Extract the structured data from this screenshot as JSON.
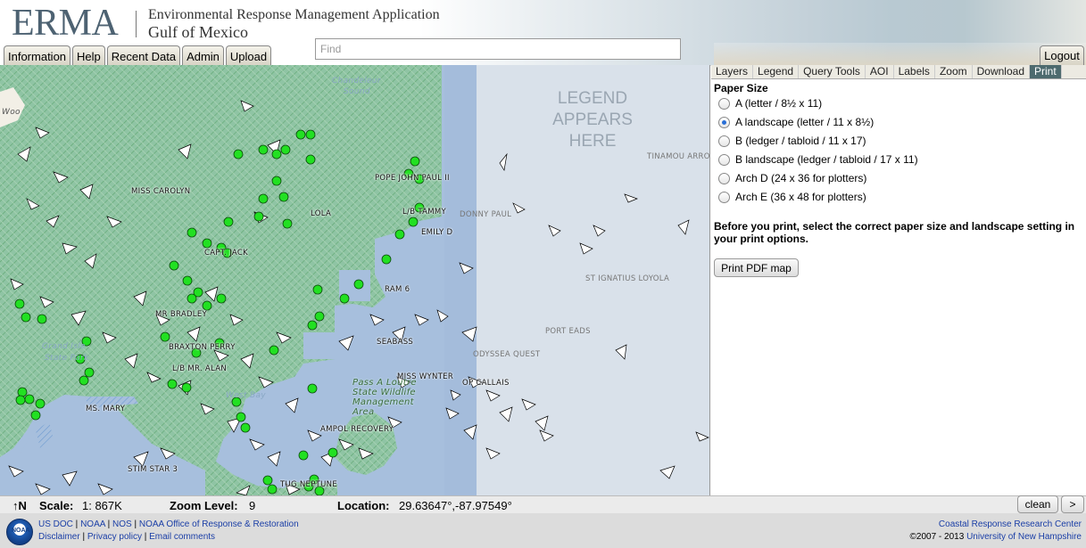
{
  "header": {
    "logo": "ERMA",
    "title": "Environmental Response Management Application",
    "subtitle": "Gulf of Mexico",
    "search_placeholder": "Find",
    "logout": "Logout"
  },
  "nav_tabs": [
    "Information",
    "Help",
    "Recent Data",
    "Admin",
    "Upload"
  ],
  "map": {
    "legend_placeholder": "LEGEND APPEARS HERE",
    "vessel_labels": [
      "MISS CAROLYN",
      "LOLA",
      "POPE JOHN PAUL II",
      "L/B TAMMY",
      "DONNY PAUL",
      "EMILY D",
      "CAPT. JACK",
      "RAM 6",
      "MR BRADLEY",
      "BRAXTON PERRY",
      "SEABASS",
      "L/B MR. ALAN",
      "MISS WYNTER",
      "OP CALLAIS",
      "MS. MARY",
      "AMPOL RECOVERY",
      "STIM STAR 3",
      "TUG NEPTUNE"
    ],
    "offshore_labels": [
      "TINAMOU ARRO",
      "ST IGNATIUS LOYOLA",
      "PORT EADS",
      "ODYSSEA QUEST"
    ],
    "place_labels": [
      "Chandeleur",
      "Sound",
      "Grand Isle",
      "State Park",
      "West Bay",
      "Woo",
      "Pass A Loutre State Wildlife Management Area"
    ]
  },
  "right_panel": {
    "tabs": [
      "Layers",
      "Legend",
      "Query Tools",
      "AOI",
      "Labels",
      "Zoom",
      "Download",
      "Print"
    ],
    "active_tab": "Print",
    "paper_size_title": "Paper Size",
    "options": [
      {
        "label": "A (letter / 8½ x 11)",
        "selected": false
      },
      {
        "label": "A landscape (letter / 11 x 8½)",
        "selected": true
      },
      {
        "label": "B (ledger / tabloid / 11 x 17)",
        "selected": false
      },
      {
        "label": "B landscape (ledger / tabloid / 17 x 11)",
        "selected": false
      },
      {
        "label": "Arch D (24 x 36 for plotters)",
        "selected": false
      },
      {
        "label": "Arch E (36 x 48 for plotters)",
        "selected": false
      }
    ],
    "note": "Before you print, select the correct paper size and landscape setting in your print options.",
    "print_button": "Print PDF map"
  },
  "status": {
    "north": "↑N",
    "scale_label": "Scale:",
    "scale_value": "1: 867K",
    "zoom_label": "Zoom Level:",
    "zoom_value": "9",
    "location_label": "Location:",
    "location_value": "29.63647°,-87.97549°",
    "clean": "clean",
    "next": ">"
  },
  "footer": {
    "links_row1": [
      "US DOC",
      "NOAA",
      "NOS",
      "NOAA Office of Response & Restoration"
    ],
    "links_row2": [
      "Disclaimer",
      "Privacy policy",
      "Email comments"
    ],
    "right_row1": "Coastal Response Research Center",
    "copyright": "©2007 - 2013",
    "right_row2_link": "University of New Hampshire",
    "noaa_logo": "NOAA"
  },
  "colors": {
    "water": "#a7bfdd",
    "offshore": "#d9e1ea",
    "land": "#8fc4a4",
    "marker": "#22e022",
    "active_tab": "#4d6a6e",
    "link": "#1a3ea6"
  }
}
